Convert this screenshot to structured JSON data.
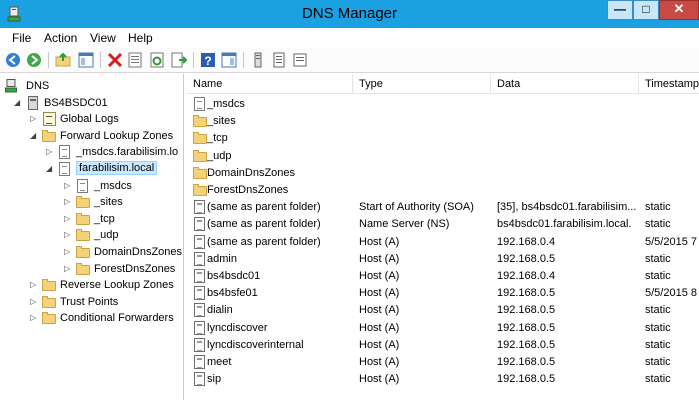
{
  "window": {
    "title": "DNS Manager"
  },
  "menu": [
    "File",
    "Action",
    "View",
    "Help"
  ],
  "toolbar_icons": [
    "back-arrow-icon",
    "forward-arrow-icon",
    "up-folder-icon",
    "show-hide-tree-icon",
    "delete-icon",
    "properties-icon",
    "refresh-icon",
    "export-list-icon",
    "help-icon",
    "show-hide-action-pane-icon",
    "new-host-icon",
    "new-alias-icon",
    "new-mail-exchanger-icon"
  ],
  "tree": [
    {
      "label": "DNS",
      "icon": "dns-icon",
      "depth": 0,
      "expander": ""
    },
    {
      "label": "BS4BSDC01",
      "icon": "server-icon",
      "depth": 1,
      "expander": "◢"
    },
    {
      "label": "Global Logs",
      "icon": "global-logs-icon",
      "depth": 2,
      "expander": "▷"
    },
    {
      "label": "Forward Lookup Zones",
      "icon": "folder-icon",
      "depth": 2,
      "expander": "◢"
    },
    {
      "label": "_msdcs.farabilisim.lo",
      "icon": "zone-icon",
      "depth": 3,
      "expander": "▷"
    },
    {
      "label": "farabilisim.local",
      "icon": "zone-icon",
      "depth": 3,
      "expander": "◢",
      "selected": true
    },
    {
      "label": "_msdcs",
      "icon": "zone-icon",
      "depth": 4,
      "expander": "▷"
    },
    {
      "label": "_sites",
      "icon": "folder-icon",
      "depth": 4,
      "expander": "▷"
    },
    {
      "label": "_tcp",
      "icon": "folder-icon",
      "depth": 4,
      "expander": "▷"
    },
    {
      "label": "_udp",
      "icon": "folder-icon",
      "depth": 4,
      "expander": "▷"
    },
    {
      "label": "DomainDnsZones",
      "icon": "folder-icon",
      "depth": 4,
      "expander": "▷"
    },
    {
      "label": "ForestDnsZones",
      "icon": "folder-icon",
      "depth": 4,
      "expander": "▷"
    },
    {
      "label": "Reverse Lookup Zones",
      "icon": "folder-icon",
      "depth": 2,
      "expander": "▷"
    },
    {
      "label": "Trust Points",
      "icon": "folder-icon",
      "depth": 2,
      "expander": "▷"
    },
    {
      "label": "Conditional Forwarders",
      "icon": "folder-icon",
      "depth": 2,
      "expander": "▷"
    }
  ],
  "list": {
    "columns": [
      "Name",
      "Type",
      "Data",
      "Timestamp"
    ],
    "rows": [
      {
        "icon": "zone-icon",
        "name": "_msdcs",
        "type": "",
        "data": "",
        "timestamp": ""
      },
      {
        "icon": "folder-icon",
        "name": "_sites",
        "type": "",
        "data": "",
        "timestamp": ""
      },
      {
        "icon": "folder-icon",
        "name": "_tcp",
        "type": "",
        "data": "",
        "timestamp": ""
      },
      {
        "icon": "folder-icon",
        "name": "_udp",
        "type": "",
        "data": "",
        "timestamp": ""
      },
      {
        "icon": "folder-icon",
        "name": "DomainDnsZones",
        "type": "",
        "data": "",
        "timestamp": ""
      },
      {
        "icon": "folder-icon",
        "name": "ForestDnsZones",
        "type": "",
        "data": "",
        "timestamp": ""
      },
      {
        "icon": "record-icon",
        "name": "(same as parent folder)",
        "type": "Start of Authority (SOA)",
        "data": "[35], bs4bsdc01.farabilisim...",
        "timestamp": "static"
      },
      {
        "icon": "record-icon",
        "name": "(same as parent folder)",
        "type": "Name Server (NS)",
        "data": "bs4bsdc01.farabilisim.local.",
        "timestamp": "static"
      },
      {
        "icon": "record-icon",
        "name": "(same as parent folder)",
        "type": "Host (A)",
        "data": "192.168.0.4",
        "timestamp": "5/5/2015 7"
      },
      {
        "icon": "record-icon",
        "name": "admin",
        "type": "Host (A)",
        "data": "192.168.0.5",
        "timestamp": "static"
      },
      {
        "icon": "record-icon",
        "name": "bs4bsdc01",
        "type": "Host (A)",
        "data": "192.168.0.4",
        "timestamp": "static"
      },
      {
        "icon": "record-icon",
        "name": "bs4bsfe01",
        "type": "Host (A)",
        "data": "192.168.0.5",
        "timestamp": "5/5/2015 8"
      },
      {
        "icon": "record-icon",
        "name": "dialin",
        "type": "Host (A)",
        "data": "192.168.0.5",
        "timestamp": "static"
      },
      {
        "icon": "record-icon",
        "name": "lyncdiscover",
        "type": "Host (A)",
        "data": "192.168.0.5",
        "timestamp": "static"
      },
      {
        "icon": "record-icon",
        "name": "lyncdiscoverinternal",
        "type": "Host (A)",
        "data": "192.168.0.5",
        "timestamp": "static"
      },
      {
        "icon": "record-icon",
        "name": "meet",
        "type": "Host (A)",
        "data": "192.168.0.5",
        "timestamp": "static"
      },
      {
        "icon": "record-icon",
        "name": "sip",
        "type": "Host (A)",
        "data": "192.168.0.5",
        "timestamp": "static"
      }
    ]
  }
}
